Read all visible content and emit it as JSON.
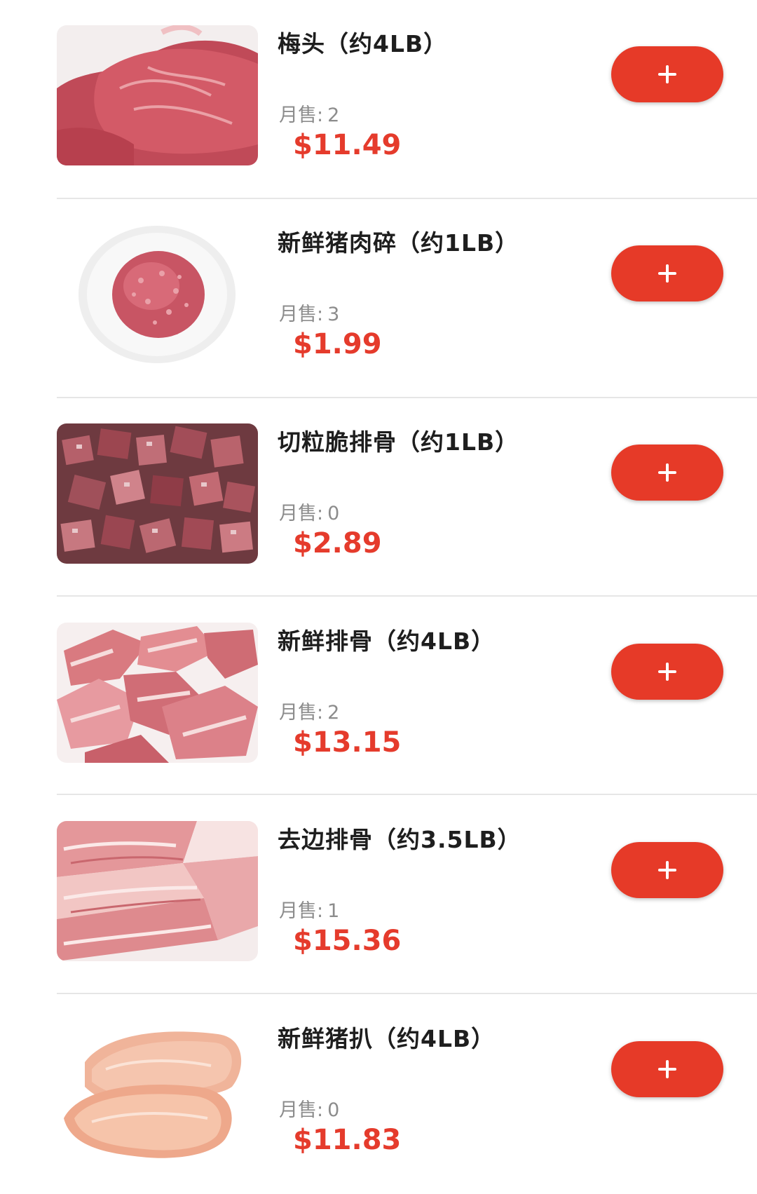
{
  "products": [
    {
      "name": "梅头（约4LB）",
      "sales_label": "月售:",
      "sales_count": "2",
      "price": "$11.49",
      "add_label": "+",
      "image": "pork-shoulder-butt",
      "image_description_color": "#c9525f"
    },
    {
      "name": "新鲜猪肉碎（约1LB）",
      "sales_label": "月售:",
      "sales_count": "3",
      "price": "$1.99",
      "add_label": "+",
      "image": "ground-pork-on-plate",
      "image_description_color": "#d0606d"
    },
    {
      "name": "切粒脆排骨（约1LB）",
      "sales_label": "月售:",
      "sales_count": "0",
      "price": "$2.89",
      "add_label": "+",
      "image": "diced-pork-ribs",
      "image_description_color": "#9c4650"
    },
    {
      "name": "新鲜排骨（约4LB）",
      "sales_label": "月售:",
      "sales_count": "2",
      "price": "$13.15",
      "add_label": "+",
      "image": "pork-spare-ribs",
      "image_description_color": "#d97a80"
    },
    {
      "name": "去边排骨（约3.5LB）",
      "sales_label": "月售:",
      "sales_count": "1",
      "price": "$15.36",
      "add_label": "+",
      "image": "trimmed-pork-ribs",
      "image_description_color": "#e08c8e"
    },
    {
      "name": "新鲜猪扒（约4LB）",
      "sales_label": "月售:",
      "sales_count": "0",
      "price": "$11.83",
      "add_label": "+",
      "image": "pork-chops",
      "image_description_color": "#efa98e"
    }
  ],
  "colors": {
    "accent": "#e63a28",
    "price": "#e53b2c",
    "name": "#1e1e1e",
    "sales": "#8c8c8c",
    "divider": "#e6e6e6"
  }
}
